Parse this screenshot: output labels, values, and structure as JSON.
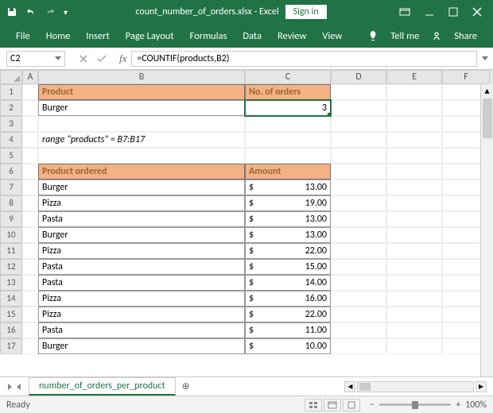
{
  "title": {
    "filename": "count_number_of_orders.xlsx",
    "app": "Excel",
    "signin": "Sign in"
  },
  "ribbon": {
    "tabs": [
      "File",
      "Home",
      "Insert",
      "Page Layout",
      "Formulas",
      "Data",
      "Review",
      "View"
    ],
    "tellme": "Tell me",
    "share": "Share"
  },
  "formula": {
    "namebox": "C2",
    "value": "=COUNTIF(products,B2)"
  },
  "columns": [
    "A",
    "B",
    "C",
    "D",
    "E",
    "F"
  ],
  "cells": {
    "B1": "Product",
    "C1": "No. of orders",
    "B2": "Burger",
    "C2": "3",
    "B4": "range \"products\" = B7:B17",
    "B6": "Product ordered",
    "C6": "Amount"
  },
  "orders": [
    {
      "p": "Burger",
      "a": "13.00"
    },
    {
      "p": "Pizza",
      "a": "19.00"
    },
    {
      "p": "Pasta",
      "a": "13.00"
    },
    {
      "p": "Burger",
      "a": "13.00"
    },
    {
      "p": "Pizza",
      "a": "22.00"
    },
    {
      "p": "Pasta",
      "a": "15.00"
    },
    {
      "p": "Pasta",
      "a": "14.00"
    },
    {
      "p": "Pizza",
      "a": "16.00"
    },
    {
      "p": "Pizza",
      "a": "22.00"
    },
    {
      "p": "Pasta",
      "a": "11.00"
    },
    {
      "p": "Burger",
      "a": "10.00"
    }
  ],
  "sheet": {
    "active": "number_of_orders_per_product"
  },
  "status": {
    "label": "Ready",
    "zoom": "100%"
  }
}
